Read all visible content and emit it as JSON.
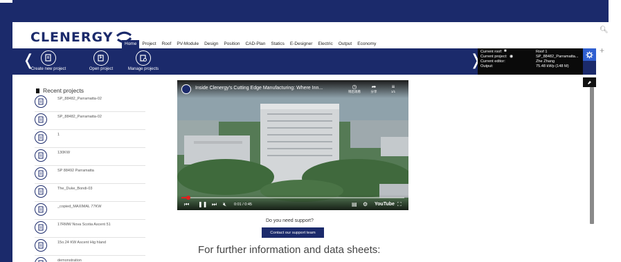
{
  "app": {
    "logo_text": "CLENERGY",
    "menu": [
      "Home",
      "Project",
      "Roof",
      "PV-Module",
      "Design",
      "Position",
      "CAD-Plan",
      "Statics",
      "E-Designer",
      "Electric",
      "Output",
      "Economy"
    ],
    "active_menu": "Home"
  },
  "ribbon": {
    "buttons": [
      {
        "label": "Create new project",
        "icon": "new-project-icon"
      },
      {
        "label": "Open project",
        "icon": "open-project-icon"
      },
      {
        "label": "Manage projects",
        "icon": "manage-projects-icon"
      }
    ],
    "info": {
      "current_roof_label": "Current roof:",
      "current_roof_value": "Roof 1",
      "current_project_label": "Current project:",
      "current_project_value": "SP_88482_Parramatta...",
      "current_editor_label": "Current editor:",
      "current_editor_value": "Zhe Zhang",
      "output_label": "Output:",
      "output_value": "75.48 kWp (148 M)"
    }
  },
  "recent": {
    "title": "Recent projects",
    "items": [
      "SP_88482_Parramatta-02",
      "SP_88482_Parramatta-02",
      "1",
      "130KW",
      "SP 88492 Parramatta",
      "The_Duke_Bondi-03",
      "_copied_MAXIMAL 77KW",
      "17RMW Nova Scotia Ascent 51",
      "15o.24 KW Ascent Hig hland",
      "demonstration"
    ]
  },
  "video": {
    "title": "Inside Clenergy's Cutting Edge Manufacturing: Where Inn...",
    "top_icons": [
      {
        "icon": "watch-later-icon",
        "label": "稍后观看"
      },
      {
        "icon": "share-icon",
        "label": "分享"
      },
      {
        "icon": "playlist-icon",
        "label": "1/1"
      }
    ],
    "time": "0:01 / 0:45",
    "progress": 0.03,
    "brand": "YouTube"
  },
  "support": {
    "question": "Do you need support?",
    "button": "Contact our support team",
    "further_info": "For further information and data sheets:"
  },
  "colors": {
    "brand_navy": "#1b2a6b",
    "accent_blue": "#2f5fd0",
    "progress_red": "#e51e1e"
  }
}
